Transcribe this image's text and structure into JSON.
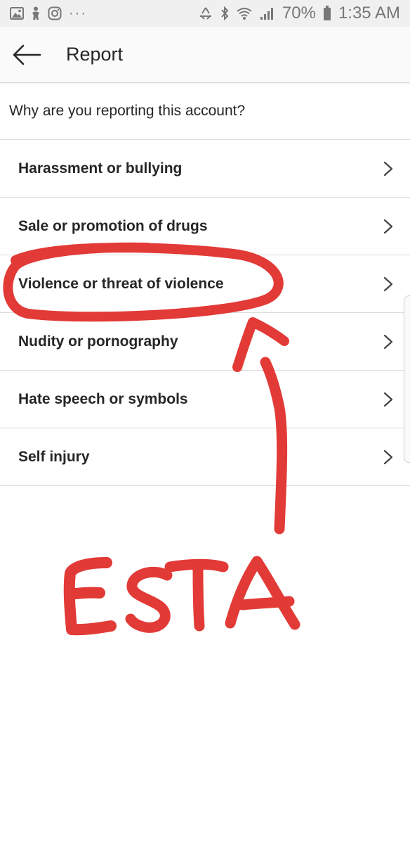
{
  "status_bar": {
    "battery": "70%",
    "time": "1:35 AM",
    "dots": "···",
    "icons": [
      "gallery-icon",
      "person-icon",
      "instagram-icon",
      "recycle-icon",
      "bluetooth-icon",
      "wifi-icon",
      "signal-icon",
      "battery-icon"
    ]
  },
  "header": {
    "back_icon": "arrow-left-icon",
    "title": "Report"
  },
  "question": "Why are you reporting this account?",
  "reasons": [
    {
      "label": "Harassment or bullying"
    },
    {
      "label": "Sale or promotion of drugs"
    },
    {
      "label": "Violence or threat of violence"
    },
    {
      "label": "Nudity or pornography"
    },
    {
      "label": "Hate speech or symbols"
    },
    {
      "label": "Self injury"
    }
  ],
  "annotation": {
    "text": "ESTA",
    "color": "#e23a36",
    "highlighted_reason": "Violence or threat of violence"
  }
}
